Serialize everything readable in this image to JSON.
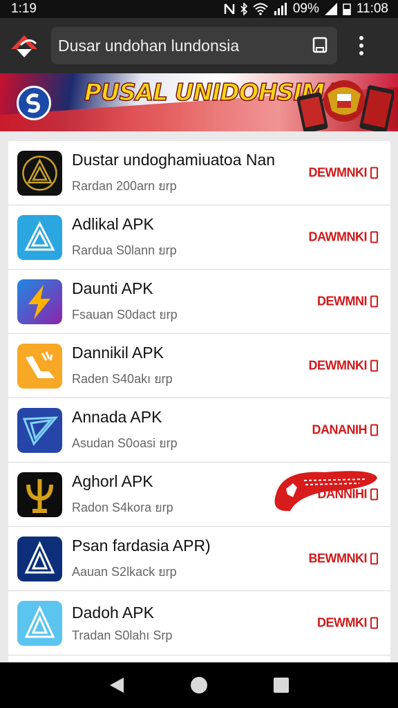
{
  "status": {
    "time_left": "1:19",
    "battery_text": "09%",
    "time_right": "11:08"
  },
  "browser": {
    "url": "Dusar undohan lundonsia"
  },
  "banner": {
    "title": "PUSAL UNIDOHSIMA"
  },
  "apps": [
    {
      "name": "Dustar undoghamiuatoa Nan",
      "sub": "Rardan  200arn  ยrp",
      "download": "DEWMNKI",
      "icon": "gold-triangle-icon"
    },
    {
      "name": "Adlikal APK",
      "sub": "Rardua  S0lann  ยrp",
      "download": "DAWMNKI",
      "icon": "blue-triangle-icon"
    },
    {
      "name": "Daunti APK",
      "sub": "Fsauan  S0dact  ยrp",
      "download": "DEWMNI",
      "icon": "lightning-icon"
    },
    {
      "name": "Dannikil APK",
      "sub": "Raden  S40akı  ยrp",
      "download": "DEWMNKI",
      "icon": "check-arrow-icon"
    },
    {
      "name": "Annada APK",
      "sub": "Asudan  S0oasi  ยrp",
      "download": "DANANIH",
      "icon": "paper-plane-icon"
    },
    {
      "name": "Aghorl APK",
      "sub": "Radon  S4kora  ยrp",
      "download": "DANNIHI",
      "icon": "trident-icon"
    },
    {
      "name": "Psan fardasia APR)",
      "sub": "Aauan  S2lkack  ยrp",
      "download": "BEWMNKI",
      "icon": "navy-triangle-icon"
    },
    {
      "name": "Dadoh APK",
      "sub": "Tradan  S0lahı  Srp",
      "download": "DEWMKI",
      "icon": "light-triangle-icon"
    }
  ],
  "colors": {
    "accent": "#cf1a1a",
    "toolbar": "#2b2b2b",
    "banner_title": "#f7d515"
  }
}
